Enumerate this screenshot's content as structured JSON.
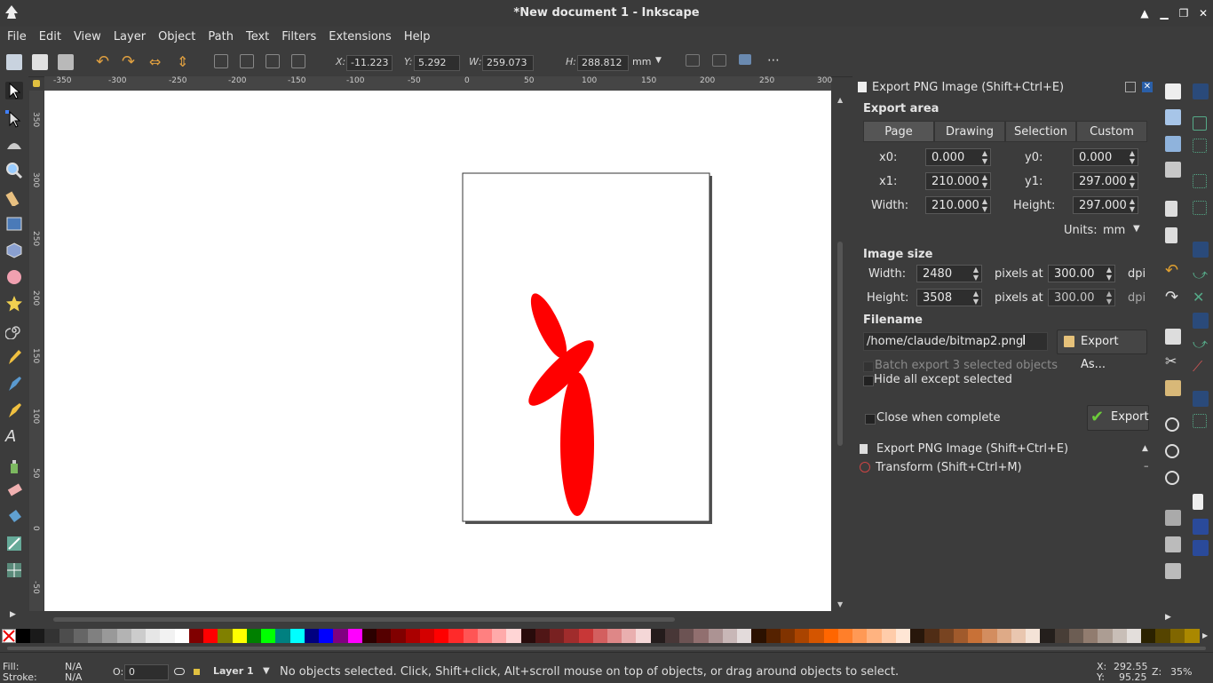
{
  "window": {
    "title": "*New document 1 - Inkscape"
  },
  "menu": [
    "File",
    "Edit",
    "View",
    "Layer",
    "Object",
    "Path",
    "Text",
    "Filters",
    "Extensions",
    "Help"
  ],
  "toolbar": {
    "x_label": "X:",
    "x_value": "-11.223",
    "y_label": "Y:",
    "y_value": "5.292",
    "w_label": "W:",
    "w_value": "259.073",
    "h_label": "H:",
    "h_value": "288.812",
    "unit": "mm"
  },
  "ruler": {
    "h_ticks": [
      "-350",
      "-300",
      "-250",
      "-200",
      "-150",
      "-100",
      "-50",
      "0",
      "50",
      "100",
      "150",
      "200",
      "250",
      "300"
    ],
    "v_ticks": [
      "350",
      "300",
      "250",
      "200",
      "150",
      "100",
      "50",
      "0",
      "-50"
    ]
  },
  "export_dialog": {
    "title": "Export PNG Image (Shift+Ctrl+E)",
    "export_area_heading": "Export area",
    "tabs": [
      "Page",
      "Drawing",
      "Selection",
      "Custom"
    ],
    "x0_label": "x0:",
    "x0": "0.000",
    "y0_label": "y0:",
    "y0": "0.000",
    "x1_label": "x1:",
    "x1": "210.000",
    "y1_label": "y1:",
    "y1": "297.000",
    "width_label": "Width:",
    "width": "210.000",
    "height_label": "Height:",
    "height": "297.000",
    "units_label": "Units:",
    "units": "mm",
    "image_size_heading": "Image size",
    "img_width_label": "Width:",
    "img_width": "2480",
    "img_height_label": "Height:",
    "img_height": "3508",
    "pixels_at": "pixels at",
    "dpi_w": "300.00",
    "dpi_h": "300.00",
    "dpi": "dpi",
    "filename_heading": "Filename",
    "filename": "/home/claude/bitmap2.png",
    "export_as": "Export As...",
    "batch_export": "Batch export 3 selected objects",
    "hide_all": "Hide all except selected",
    "close_when_complete": "Close when complete",
    "export_btn": "Export"
  },
  "docked": [
    {
      "label": "Export PNG Image (Shift+Ctrl+E)"
    },
    {
      "label": "Transform (Shift+Ctrl+M)"
    }
  ],
  "palette": [
    "#000000",
    "#1a1a1a",
    "#333333",
    "#4d4d4d",
    "#666666",
    "#808080",
    "#999999",
    "#b3b3b3",
    "#cccccc",
    "#e6e6e6",
    "#f2f2f2",
    "#ffffff",
    "#800000",
    "#ff0000",
    "#808000",
    "#ffff00",
    "#008000",
    "#00ff00",
    "#008080",
    "#00ffff",
    "#000080",
    "#0000ff",
    "#800080",
    "#ff00ff",
    "#2b0000",
    "#550000",
    "#800000",
    "#aa0000",
    "#d40000",
    "#ff0000",
    "#ff2a2a",
    "#ff5555",
    "#ff8080",
    "#ffaaaa",
    "#ffd5d5",
    "#280b0b",
    "#501616",
    "#782121",
    "#a02c2c",
    "#c83737",
    "#d35f5f",
    "#de8787",
    "#e9afaf",
    "#f4d7d7",
    "#241c1c",
    "#483737",
    "#6c5353",
    "#916f6f",
    "#ac9393",
    "#c8b7b7",
    "#e3dbdb",
    "#2b1100",
    "#552200",
    "#803300",
    "#aa4400",
    "#d45500",
    "#ff6600",
    "#ff7f2a",
    "#ff9955",
    "#ffb380",
    "#ffccaa",
    "#ffe6d5",
    "#28170b",
    "#502d16",
    "#784421",
    "#a05a2c",
    "#c87137",
    "#d38d5f",
    "#deaa87",
    "#e9c6af",
    "#f4e3d7",
    "#241f1c",
    "#483e37",
    "#6c5d53",
    "#917c6f",
    "#ac9d93",
    "#c8beb7",
    "#e3dedb",
    "#2b2200",
    "#554400",
    "#806600",
    "#aa8800"
  ],
  "status": {
    "fill_label": "Fill:",
    "fill": "N/A",
    "stroke_label": "Stroke:",
    "stroke": "N/A",
    "opacity_label": "O:",
    "opacity": "0",
    "layer": "Layer 1",
    "message": "No objects selected. Click, Shift+click, Alt+scroll mouse on top of objects, or drag around objects to select.",
    "x_label": "X:",
    "x": "292.55",
    "y_label": "Y:",
    "y": "95.25",
    "zoom_label": "Z:",
    "zoom": "35%"
  },
  "colors": {
    "accent_shape": "#ff0000",
    "export_check": "#6ccb3a"
  }
}
